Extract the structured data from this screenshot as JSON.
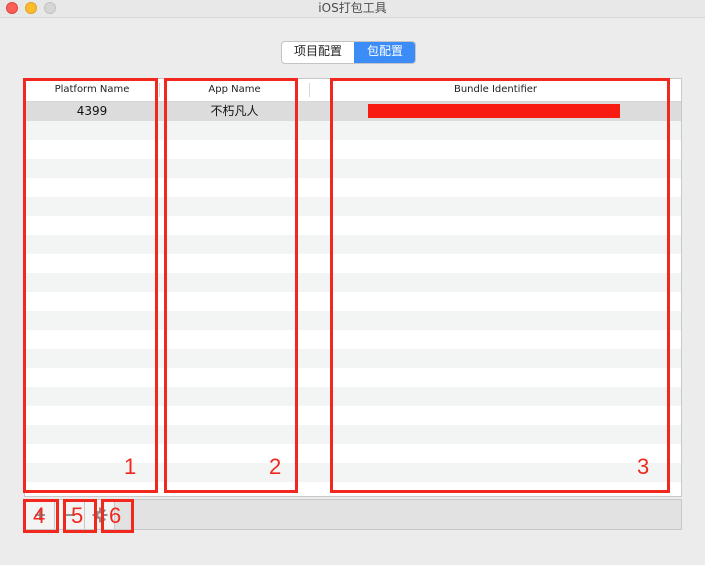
{
  "window": {
    "title": "iOS打包工具"
  },
  "segmented": {
    "tabs": [
      "项目配置",
      "包配置"
    ],
    "active_index": 1
  },
  "table": {
    "columns": [
      "Platform Name",
      "App Name",
      "Bundle Identifier"
    ],
    "rows": [
      {
        "platform": "4399",
        "app_name": "不朽凡人",
        "bundle_id": ""
      }
    ]
  },
  "toolbar": {
    "add_icon": "plus-icon",
    "remove_icon": "minus-icon",
    "settings_icon": "gear-icon"
  },
  "annotations": [
    "1",
    "2",
    "3",
    "4",
    "5",
    "6"
  ],
  "colors": {
    "annotation": "#f0281e",
    "redaction": "#f71b12",
    "segment_active": "#3b8cf6"
  }
}
